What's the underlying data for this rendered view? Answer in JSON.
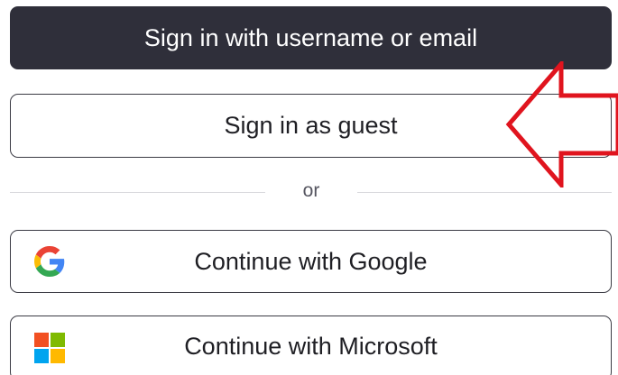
{
  "buttons": {
    "username_email": "Sign in with username or email",
    "guest": "Sign in as guest",
    "google": "Continue with Google",
    "microsoft": "Continue with Microsoft"
  },
  "divider": {
    "text": "or"
  },
  "icons": {
    "google": "google-logo-icon",
    "microsoft": "microsoft-logo-icon",
    "annotation": "red-arrow-annotation"
  },
  "colors": {
    "primary_button_bg": "#2f2f3a",
    "primary_button_text": "#ffffff",
    "outline_border": "#3b3b44",
    "annotation_arrow": "#e0141e"
  }
}
